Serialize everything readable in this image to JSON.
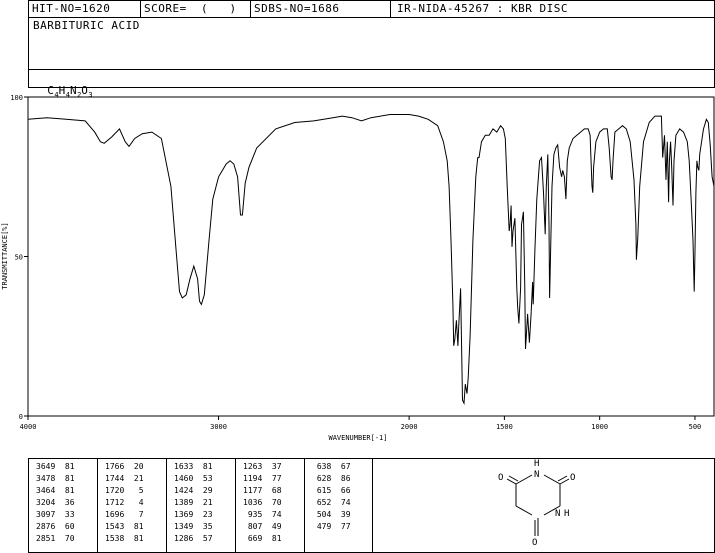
{
  "header": {
    "hit_no": "HIT-NO=1620",
    "score": "SCORE=  (   )",
    "sdbs_no": "SDBS-NO=1686",
    "ir_info": "IR-NIDA-45267 : KBR DISC"
  },
  "compound": {
    "name": "BARBITURIC ACID",
    "formula_parts": [
      "C",
      "4",
      "H",
      "4",
      "N",
      "2",
      "O",
      "3"
    ]
  },
  "chart_data": {
    "type": "line",
    "xlabel": "WAVENUMBER[-1]",
    "ylabel": "TRANSMITTANCE[%]",
    "xlim": [
      4000,
      400
    ],
    "ylim": [
      0,
      100
    ],
    "x_ticks": [
      4000,
      3000,
      2000,
      1500,
      1000,
      500
    ],
    "y_ticks": [
      0,
      50,
      100
    ],
    "grid": false,
    "series": [
      {
        "points": [
          [
            4000,
            93
          ],
          [
            3900,
            93.5
          ],
          [
            3800,
            93
          ],
          [
            3700,
            92.5
          ],
          [
            3650,
            89
          ],
          [
            3620,
            86
          ],
          [
            3600,
            85.5
          ],
          [
            3560,
            87.5
          ],
          [
            3520,
            90
          ],
          [
            3490,
            86
          ],
          [
            3470,
            84.5
          ],
          [
            3440,
            87
          ],
          [
            3400,
            88.5
          ],
          [
            3350,
            89
          ],
          [
            3300,
            87
          ],
          [
            3250,
            72
          ],
          [
            3220,
            50
          ],
          [
            3205,
            39
          ],
          [
            3190,
            37
          ],
          [
            3170,
            38
          ],
          [
            3150,
            43
          ],
          [
            3130,
            47
          ],
          [
            3110,
            43
          ],
          [
            3100,
            36
          ],
          [
            3090,
            35
          ],
          [
            3075,
            38
          ],
          [
            3050,
            55
          ],
          [
            3030,
            68
          ],
          [
            3000,
            75
          ],
          [
            2960,
            79
          ],
          [
            2940,
            80
          ],
          [
            2920,
            79
          ],
          [
            2900,
            75
          ],
          [
            2885,
            63
          ],
          [
            2875,
            63
          ],
          [
            2860,
            73
          ],
          [
            2840,
            78
          ],
          [
            2800,
            84
          ],
          [
            2700,
            90
          ],
          [
            2600,
            92
          ],
          [
            2500,
            92.5
          ],
          [
            2400,
            93.5
          ],
          [
            2350,
            94
          ],
          [
            2300,
            93.5
          ],
          [
            2250,
            92.5
          ],
          [
            2200,
            93.5
          ],
          [
            2100,
            94.5
          ],
          [
            2000,
            94.5
          ],
          [
            1950,
            94
          ],
          [
            1900,
            93
          ],
          [
            1850,
            91
          ],
          [
            1820,
            86
          ],
          [
            1800,
            80
          ],
          [
            1790,
            72
          ],
          [
            1780,
            55
          ],
          [
            1770,
            35
          ],
          [
            1766,
            22
          ],
          [
            1760,
            24
          ],
          [
            1752,
            30
          ],
          [
            1744,
            22
          ],
          [
            1740,
            28
          ],
          [
            1730,
            40
          ],
          [
            1720,
            5
          ],
          [
            1712,
            4
          ],
          [
            1705,
            10
          ],
          [
            1696,
            7
          ],
          [
            1690,
            12
          ],
          [
            1680,
            25
          ],
          [
            1665,
            55
          ],
          [
            1650,
            75
          ],
          [
            1640,
            81
          ],
          [
            1633,
            81
          ],
          [
            1620,
            86
          ],
          [
            1600,
            88
          ],
          [
            1580,
            88
          ],
          [
            1560,
            90
          ],
          [
            1540,
            89
          ],
          [
            1520,
            91
          ],
          [
            1505,
            90
          ],
          [
            1495,
            87
          ],
          [
            1485,
            72
          ],
          [
            1475,
            58
          ],
          [
            1470,
            60
          ],
          [
            1465,
            66
          ],
          [
            1460,
            53
          ],
          [
            1455,
            58
          ],
          [
            1445,
            62
          ],
          [
            1435,
            40
          ],
          [
            1430,
            34
          ],
          [
            1424,
            29
          ],
          [
            1415,
            40
          ],
          [
            1410,
            60
          ],
          [
            1405,
            62
          ],
          [
            1400,
            64
          ],
          [
            1393,
            40
          ],
          [
            1389,
            21
          ],
          [
            1385,
            25
          ],
          [
            1378,
            32
          ],
          [
            1369,
            23
          ],
          [
            1360,
            32
          ],
          [
            1352,
            42
          ],
          [
            1349,
            35
          ],
          [
            1340,
            52
          ],
          [
            1330,
            68
          ],
          [
            1315,
            80
          ],
          [
            1305,
            81
          ],
          [
            1295,
            70
          ],
          [
            1286,
            57
          ],
          [
            1280,
            72
          ],
          [
            1272,
            82
          ],
          [
            1266,
            60
          ],
          [
            1263,
            37
          ],
          [
            1258,
            50
          ],
          [
            1250,
            72
          ],
          [
            1240,
            82
          ],
          [
            1230,
            84
          ],
          [
            1220,
            85
          ],
          [
            1210,
            78
          ],
          [
            1200,
            75
          ],
          [
            1194,
            77
          ],
          [
            1185,
            75
          ],
          [
            1177,
            68
          ],
          [
            1170,
            80
          ],
          [
            1160,
            84
          ],
          [
            1140,
            87
          ],
          [
            1120,
            88
          ],
          [
            1100,
            89
          ],
          [
            1080,
            90
          ],
          [
            1060,
            90
          ],
          [
            1050,
            88
          ],
          [
            1040,
            72
          ],
          [
            1036,
            70
          ],
          [
            1032,
            78
          ],
          [
            1020,
            86
          ],
          [
            1000,
            89
          ],
          [
            980,
            90
          ],
          [
            960,
            90
          ],
          [
            950,
            84
          ],
          [
            940,
            75
          ],
          [
            935,
            74
          ],
          [
            930,
            80
          ],
          [
            920,
            89
          ],
          [
            900,
            90
          ],
          [
            880,
            91
          ],
          [
            860,
            90
          ],
          [
            840,
            86
          ],
          [
            820,
            74
          ],
          [
            810,
            60
          ],
          [
            807,
            49
          ],
          [
            800,
            56
          ],
          [
            790,
            72
          ],
          [
            770,
            86
          ],
          [
            740,
            92
          ],
          [
            710,
            94
          ],
          [
            690,
            94
          ],
          [
            676,
            94
          ],
          [
            669,
            81
          ],
          [
            660,
            88
          ],
          [
            652,
            74
          ],
          [
            645,
            86
          ],
          [
            638,
            67
          ],
          [
            634,
            80
          ],
          [
            628,
            86
          ],
          [
            622,
            78
          ],
          [
            615,
            66
          ],
          [
            610,
            80
          ],
          [
            600,
            88
          ],
          [
            580,
            90
          ],
          [
            560,
            89
          ],
          [
            540,
            86
          ],
          [
            530,
            80
          ],
          [
            520,
            68
          ],
          [
            510,
            55
          ],
          [
            504,
            39
          ],
          [
            500,
            50
          ],
          [
            495,
            70
          ],
          [
            490,
            80
          ],
          [
            485,
            78
          ],
          [
            479,
            77
          ],
          [
            475,
            82
          ],
          [
            465,
            86
          ],
          [
            455,
            90
          ],
          [
            440,
            93
          ],
          [
            430,
            92
          ],
          [
            420,
            85
          ],
          [
            410,
            75
          ],
          [
            400,
            72
          ]
        ]
      }
    ]
  },
  "peaks": {
    "columns": [
      [
        [
          "3649",
          "81"
        ],
        [
          "3478",
          "81"
        ],
        [
          "3464",
          "81"
        ],
        [
          "3204",
          "36"
        ],
        [
          "3097",
          "33"
        ],
        [
          "2876",
          "60"
        ],
        [
          "2851",
          "70"
        ]
      ],
      [
        [
          "1766",
          "20"
        ],
        [
          "1744",
          "21"
        ],
        [
          "1720",
          "5"
        ],
        [
          "1712",
          "4"
        ],
        [
          "1696",
          "7"
        ],
        [
          "1543",
          "81"
        ],
        [
          "1538",
          "81"
        ]
      ],
      [
        [
          "1633",
          "81"
        ],
        [
          "1460",
          "53"
        ],
        [
          "1424",
          "29"
        ],
        [
          "1389",
          "21"
        ],
        [
          "1369",
          "23"
        ],
        [
          "1349",
          "35"
        ],
        [
          "1286",
          "57"
        ]
      ],
      [
        [
          "1263",
          "37"
        ],
        [
          "1194",
          "77"
        ],
        [
          "1177",
          "68"
        ],
        [
          "1036",
          "70"
        ],
        [
          "935",
          "74"
        ],
        [
          "807",
          "49"
        ],
        [
          "669",
          "81"
        ]
      ],
      [
        [
          "638",
          "67"
        ],
        [
          "628",
          "86"
        ],
        [
          "615",
          "66"
        ],
        [
          "652",
          "74"
        ],
        [
          "504",
          "39"
        ],
        [
          "479",
          "77"
        ]
      ]
    ]
  },
  "structure": {
    "atom_labels": [
      "O",
      "H",
      "N",
      "O",
      "N",
      "H",
      "O"
    ]
  }
}
